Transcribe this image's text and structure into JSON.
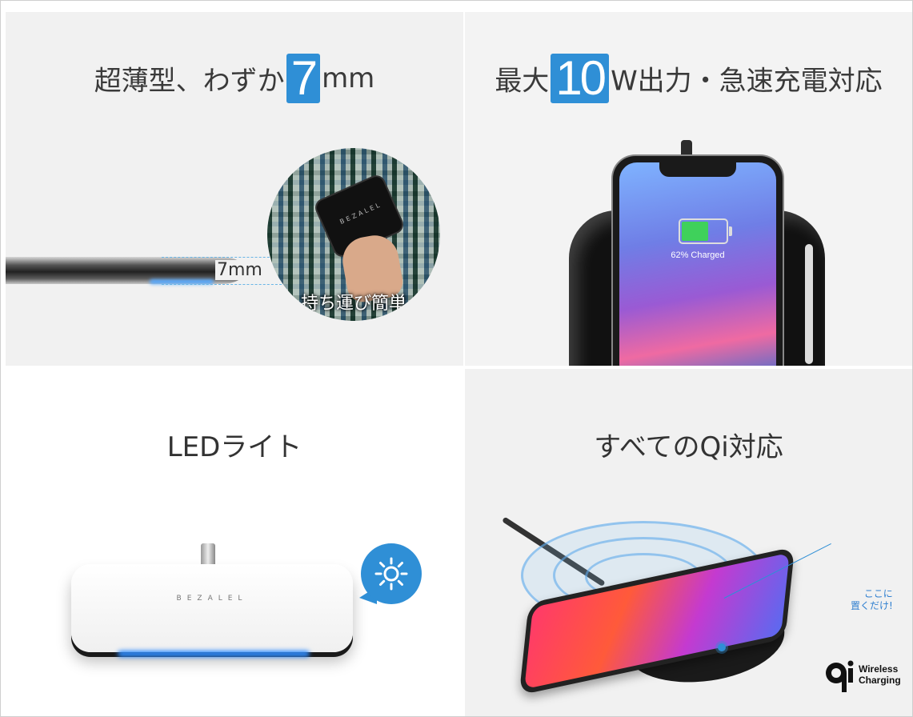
{
  "panels": {
    "thin": {
      "headline_prefix": "超薄型、わずか",
      "headline_number": "7",
      "headline_suffix": "mm",
      "dimension_label": "7mm",
      "circle_caption": "持ち運び簡単",
      "device_brand": "BEZALEL"
    },
    "power": {
      "headline_prefix": "最大",
      "headline_number": "10",
      "headline_suffix": "W出力・急速充電対応",
      "battery_percent": 62,
      "screen_text": "62% Charged"
    },
    "led": {
      "title": "LEDライト",
      "device_brand": "BEZALEL",
      "icon": "sun-icon"
    },
    "qi": {
      "title": "すべてのQi対応",
      "note_line1": "ここに",
      "note_line2": "置くだけ!",
      "logo_line1": "Wireless",
      "logo_line2": "Charging"
    }
  },
  "colors": {
    "accent_blue": "#2f8fd6",
    "battery_green": "#3fd15b",
    "text_dark": "#3a3a3a"
  }
}
